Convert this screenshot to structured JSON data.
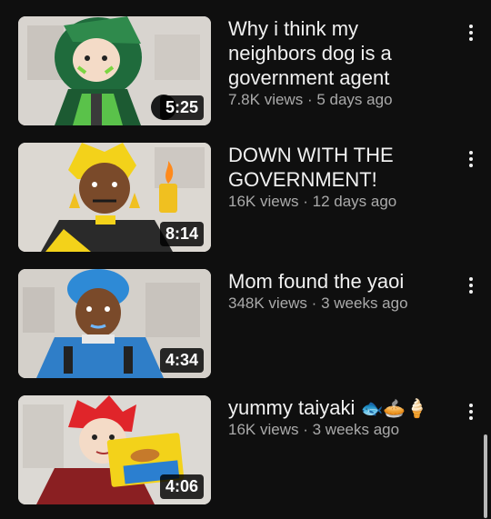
{
  "videos": [
    {
      "title": "Why i think my neighbors dog is a government agent",
      "views": "7.8K views",
      "age": "5 days ago",
      "duration": "5:25"
    },
    {
      "title": "DOWN WITH THE GOVERNMENT!",
      "views": "16K views",
      "age": "12 days ago",
      "duration": "8:14"
    },
    {
      "title": "Mom found the yaoi",
      "views": "348K views",
      "age": "3 weeks ago",
      "duration": "4:34"
    },
    {
      "title": "yummy taiyaki",
      "title_emojis": "🐟🥧🍦",
      "views": "16K views",
      "age": "3 weeks ago",
      "duration": "4:06"
    }
  ],
  "separator": "·",
  "colors": {
    "background": "#0f0f0f",
    "title": "#f1f1f1",
    "meta": "#aaaaaa"
  }
}
